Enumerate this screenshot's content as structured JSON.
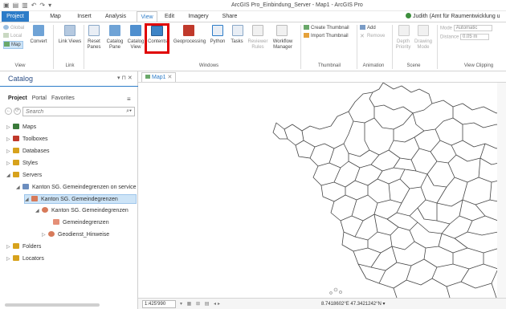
{
  "title_bar": {
    "app_title": "ArcGIS Pro_Einbindung_Server - Map1 - ArcGIS Pro"
  },
  "tabs": [
    "Project",
    "Map",
    "Insert",
    "Analysis",
    "View",
    "Edit",
    "Imagery",
    "Share"
  ],
  "active_tab": "View",
  "user": "Judith (Amt für Raumentwicklung u",
  "ribbon": {
    "view_group": {
      "global": "Global",
      "local": "Local",
      "map": "Map",
      "convert": "Convert",
      "label": "View"
    },
    "link_group": {
      "link_views": "Link Views",
      "label": "Link"
    },
    "windows_group": {
      "reset_panes": "Reset Panes",
      "catalog_pane": "Catalog Pane",
      "catalog_view": "Catalog View",
      "contents": "Contents",
      "geoprocessing": "Geoprocessing",
      "python": "Python",
      "tasks": "Tasks",
      "reviewer_rules": "Reviewer Rules",
      "workflow_manager": "Workflow Manager",
      "label": "Windows"
    },
    "thumbnail_group": {
      "create": "Create Thumbnail",
      "import": "Import Thumbnail",
      "label": "Thumbnail"
    },
    "animation_group": {
      "add": "Add",
      "remove": "Remove",
      "label": "Animation"
    },
    "scene_group": {
      "depth_priority": "Depth Priority",
      "drawing_mode": "Drawing Mode",
      "label": "Scene"
    },
    "clipping_group": {
      "mode_label": "Mode",
      "mode_value": "Automatic",
      "distance_label": "Distance",
      "distance_value": "0.05 m",
      "label": "View Clipping"
    }
  },
  "catalog": {
    "title": "Catalog",
    "controls": "▾ ⊓ ✕",
    "tabs": [
      "Project",
      "Portal",
      "Favorites"
    ],
    "search_placeholder": "Search",
    "items": [
      {
        "label": "Maps",
        "twisty": "▷",
        "color": "#3a7a3a"
      },
      {
        "label": "Toolboxes",
        "twisty": "▷",
        "color": "#c0392b"
      },
      {
        "label": "Databases",
        "twisty": "▷",
        "color": "#d7a21c"
      },
      {
        "label": "Styles",
        "twisty": "▷",
        "color": "#d7a21c"
      },
      {
        "label": "Servers",
        "twisty": "◢",
        "color": "#d7a21c"
      },
      {
        "label": "Kanton SG. Gemeindegrenzen on service",
        "twisty": "◢",
        "color": "#6c8ebf"
      },
      {
        "label": "Kanton SG. Gemeindegrenzen",
        "twisty": "◢",
        "color": "#d77a5a"
      },
      {
        "label": "Kanton SG. Gemeindegrenzen",
        "twisty": "◢",
        "color": "#d77a5a"
      },
      {
        "label": "Gemeindegrenzen",
        "twisty": "",
        "color": "#e58f77"
      },
      {
        "label": "Geodienst_Hinweise",
        "twisty": "▷",
        "color": "#d77a5a"
      },
      {
        "label": "Folders",
        "twisty": "▷",
        "color": "#d7a21c"
      },
      {
        "label": "Locators",
        "twisty": "▷",
        "color": "#d7a21c"
      }
    ]
  },
  "map": {
    "tab_label": "Map1",
    "scale": "1:425'990",
    "coordinates": "8.7418602°E 47.3421242°N"
  },
  "colors": {
    "accent": "#2d7cc8",
    "highlight": "#e00000"
  }
}
